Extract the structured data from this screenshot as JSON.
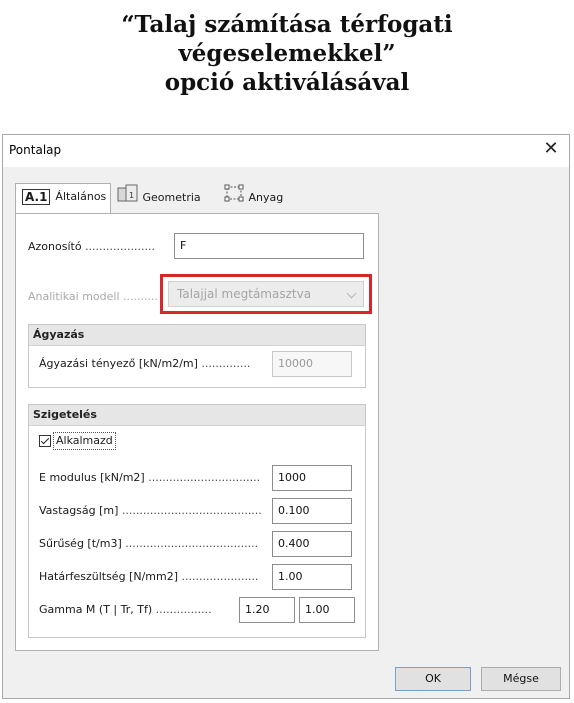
{
  "caption": {
    "line1": "“Talaj számítása térfogati",
    "line2": "végeselemekkel”",
    "line3": "opció aktiválásával"
  },
  "dialog": {
    "title": "Pontalap",
    "close_icon": "close-icon"
  },
  "tabs": [
    {
      "badge": "A.1",
      "label": "Általános",
      "active": true,
      "icon": "general-badge-icon"
    },
    {
      "label": "Geometria",
      "active": false,
      "icon": "geometry-icon"
    },
    {
      "label": "Anyag",
      "active": false,
      "icon": "material-icon"
    }
  ],
  "general": {
    "id_label": "Azonosító",
    "id_dots": "....................",
    "id_value": "F",
    "model_label": "Analitikai modell",
    "model_dots": "..........",
    "model_value": "Talajjal megtámasztva"
  },
  "bedding": {
    "title": "Ágyazás",
    "coef_label": "Ágyazási tényező [kN/m2/m]",
    "coef_dots": "..............",
    "coef_value": "10000"
  },
  "insulation": {
    "title": "Szigetelés",
    "apply_label": "Alkalmazd",
    "apply_checked": true,
    "rows": [
      {
        "label": "E modulus [kN/m2]",
        "dots": "................................",
        "value": "1000"
      },
      {
        "label": "Vastagság [m]",
        "dots": "........................................",
        "value": "0.100"
      },
      {
        "label": "Sűrűség [t/m3]",
        "dots": "......................................",
        "value": "0.400"
      },
      {
        "label": "Határfeszültség [N/mm2]",
        "dots": "......................",
        "value": "1.00"
      }
    ],
    "gamma_label": "Gamma M (T | Tr, Tf)",
    "gamma_dots": "................",
    "gamma_value1": "1.20",
    "gamma_value2": "1.00"
  },
  "buttons": {
    "ok": "OK",
    "cancel": "Mégse"
  },
  "colors": {
    "highlight": "#d9262c",
    "dialog_bg": "#f0f0f0"
  }
}
